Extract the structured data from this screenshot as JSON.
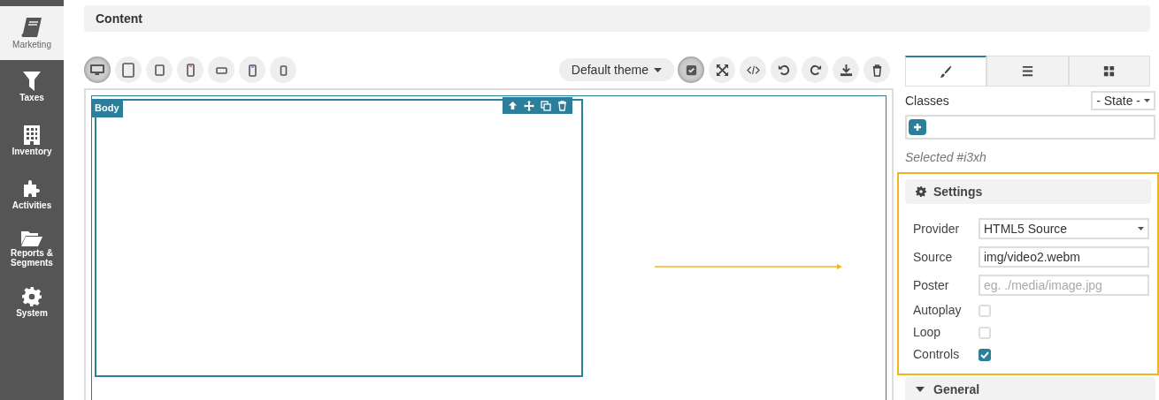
{
  "sidebar": {
    "items": [
      {
        "label": "Marketing",
        "selected": true
      },
      {
        "label": "Taxes",
        "selected": false
      },
      {
        "label": "Inventory",
        "selected": false
      },
      {
        "label": "Activities",
        "selected": false
      },
      {
        "label": "Reports & Segments",
        "selected": false
      },
      {
        "label": "System",
        "selected": false
      }
    ]
  },
  "header": {
    "title": "Content"
  },
  "devices": [
    {
      "selected": true
    },
    {
      "selected": false
    },
    {
      "selected": false
    },
    {
      "selected": false
    },
    {
      "selected": false
    },
    {
      "selected": false
    },
    {
      "selected": false
    }
  ],
  "theme_dropdown": {
    "label": "Default theme"
  },
  "tools": [
    {
      "on": true
    },
    {
      "on": false
    },
    {
      "on": false
    },
    {
      "on": false
    },
    {
      "on": false
    },
    {
      "on": false
    },
    {
      "on": false
    }
  ],
  "canvas": {
    "badge": "Body"
  },
  "panel_tabs": [
    {
      "selected": true
    },
    {
      "selected": false
    },
    {
      "selected": false
    }
  ],
  "classes": {
    "label": "Classes",
    "state_select": "- State -",
    "selected_text": "Selected #i3xh"
  },
  "settings": {
    "title": "Settings",
    "fields": [
      {
        "label": "Provider",
        "kind": "select",
        "value": "HTML5 Source"
      },
      {
        "label": "Source",
        "kind": "text",
        "value": "img/video2.webm"
      },
      {
        "label": "Poster",
        "kind": "text",
        "placeholder": "eg. ./media/image.jpg"
      },
      {
        "label": "Autoplay",
        "kind": "checkbox",
        "checked": false
      },
      {
        "label": "Loop",
        "kind": "checkbox",
        "checked": false
      },
      {
        "label": "Controls",
        "kind": "checkbox",
        "checked": true
      }
    ]
  },
  "general": {
    "title": "General"
  }
}
